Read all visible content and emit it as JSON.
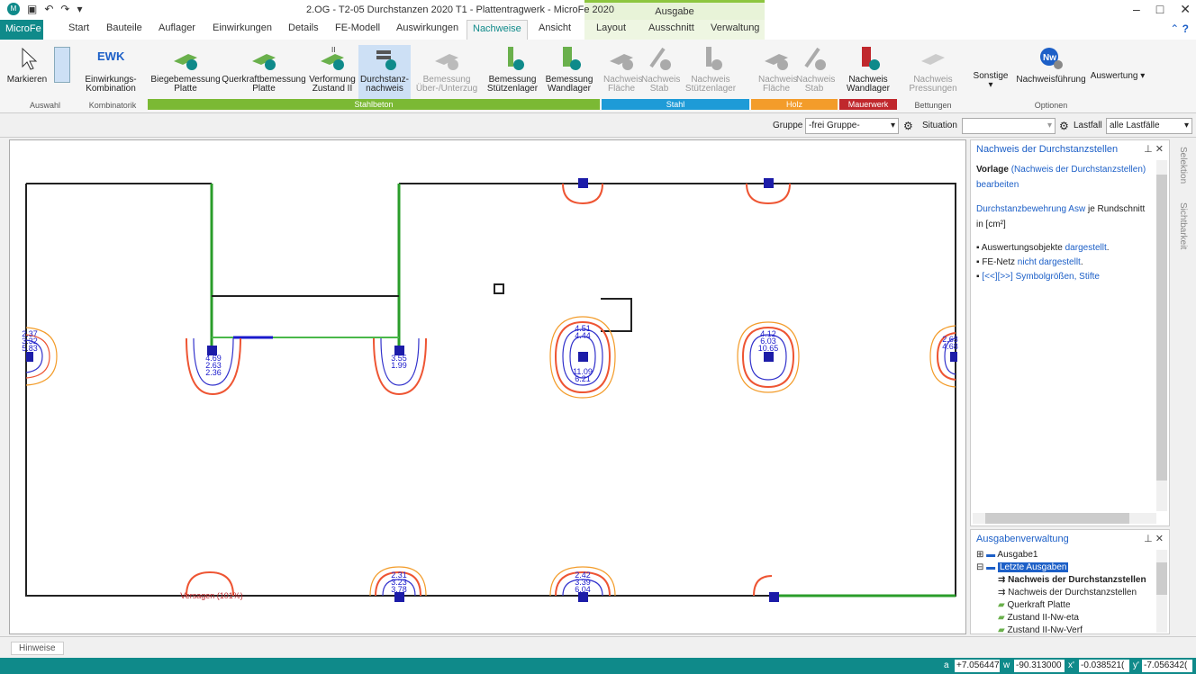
{
  "window": {
    "title": "2.OG - T2-05 Durchstanzen 2020 T1 - Plattentragwerk - MicroFe 2020",
    "context_label": "Ausgabe"
  },
  "tabs": {
    "app": "MicroFe",
    "items": [
      "Start",
      "Bauteile",
      "Auflager",
      "Einwirkungen",
      "Details",
      "FE-Modell",
      "Auswirkungen",
      "Nachweise",
      "Ansicht",
      "Layout",
      "Ausschnitt",
      "Verwaltung"
    ],
    "active": "Nachweise"
  },
  "ribbon": {
    "markieren": "Markieren",
    "auswahl": "Auswahl",
    "ewk": "EWK",
    "ewk_label": "Einwirkungs-\nKombination",
    "kombinatorik": "Kombinatorik",
    "biege": "Biegebemessung\nPlatte",
    "querkraft": "Querkraftbemessung\nPlatte",
    "verformung": "Verformung\nZustand II",
    "durchstanz": "Durchstanz-\nnachweis",
    "bem_unterzug": "Bemessung\nÜber-/Unterzug",
    "bem_stuetz": "Bemessung\nStützenlager",
    "bem_wand": "Bemessung\nWandlager",
    "stahlbeton": "Stahlbeton",
    "n_flaeche": "Nachweis\nFläche",
    "n_stab": "Nachweis\nStab",
    "n_stuetz": "Nachweis\nStützenlager",
    "stahl": "Stahl",
    "h_flaeche": "Nachweis\nFläche",
    "h_stab": "Nachweis\nStab",
    "holz": "Holz",
    "n_wand": "Nachweis\nWandlager",
    "mauerwerk": "Mauerwerk",
    "n_press": "Nachweis\nPressungen",
    "bettungen": "Bettungen",
    "sonstige": "Sonstige",
    "nachweisfuehrung": "Nachweisführung",
    "auswertung": "Auswertung",
    "optionen": "Optionen",
    "zustand_mark": "II"
  },
  "toolbar2": {
    "gruppe_label": "Gruppe",
    "gruppe_value": "-frei Gruppe-",
    "situation_label": "Situation",
    "lastfall_label": "Lastfall",
    "lastfall_value": "alle Lastfälle"
  },
  "panel": {
    "title": "Nachweis der Durchstanzstellen",
    "vorlage": "Vorlage",
    "vorlage_link": "(Nachweis der Durchstanzstellen)",
    "bearbeiten": "bearbeiten",
    "asw_link": "Durchstanzbewehrung Asw",
    "asw_rest": "je Rundschnitt",
    "unit": "in [cm²]",
    "b1_text": "Auswertungsobjekte",
    "b1_link": "dargestellt",
    "b2_text": "FE-Netz",
    "b2_link": "nicht dargestellt",
    "b3_link": "[<<][>>] Symbolgrößen, Stifte"
  },
  "ausgaben": {
    "title": "Ausgabenverwaltung",
    "items": [
      "Ausgabe1",
      "Letzte Ausgaben",
      "Nachweis der Durchstanzstellen",
      "Nachweis der Durchstanzstellen",
      "Querkraft Platte",
      "Zustand II-Nw-eta",
      "Zustand II-Nw-Verf"
    ]
  },
  "side_tabs": [
    "Selektion",
    "Sichtbarkeit"
  ],
  "hinweise": "Hinweise",
  "status": {
    "a_label": "a",
    "a_value": "+7.056447",
    "w_label": "w",
    "w_value": "-90.313000",
    "x_label": "x'",
    "x_value": "-0.038521(",
    "y_label": "y'",
    "y_value": "-7.056342("
  },
  "plot_labels": {
    "l1": "2.37",
    "l2": "3.32",
    "l3": "5.83",
    "c1a": "4.69",
    "c1b": "2.63",
    "c1c": "2.36",
    "c2a": "3.55",
    "c2b": "1.99",
    "c3a": "4.51",
    "c3b": "4.44",
    "c3c": "11.09",
    "c3d": "6.21",
    "c4a": "4.12",
    "c4b": "6.03",
    "c4c": "10.65",
    "r1": "2.63",
    "r2": "4.68",
    "b1a": "2.31",
    "b1b": "3.23",
    "b1c": "3.78",
    "b2a": "2.42",
    "b2b": "3.39",
    "b2c": "6.04",
    "fail": "Versagen (101%)"
  }
}
